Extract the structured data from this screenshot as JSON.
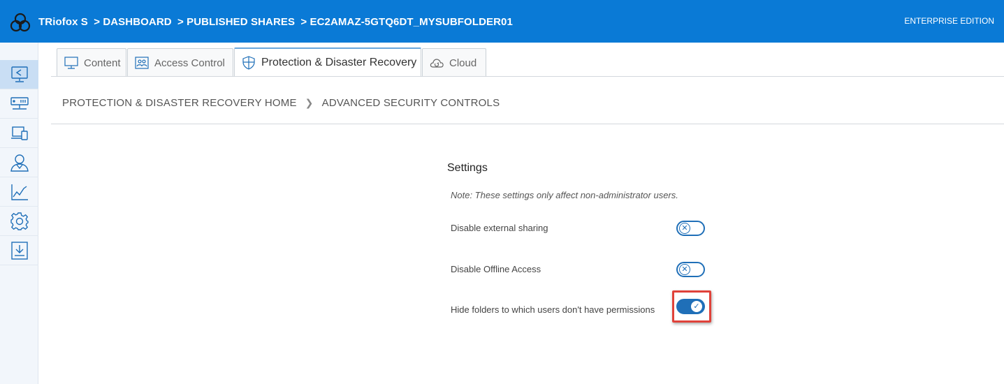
{
  "header": {
    "breadcrumb": [
      "TRiofox S",
      "> DASHBOARD",
      "> PUBLISHED SHARES",
      "> EC2AMAZ-5GTQ6DT_MYSUBFOLDER01"
    ],
    "edition": "ENTERPRISE EDITION",
    "color": "#0a7ad6"
  },
  "sidebar": {
    "items": [
      {
        "icon": "share-screen-icon",
        "active": true
      },
      {
        "icon": "server-icon",
        "active": false
      },
      {
        "icon": "devices-icon",
        "active": false
      },
      {
        "icon": "user-icon",
        "active": false
      },
      {
        "icon": "chart-icon",
        "active": false
      },
      {
        "icon": "gear-icon",
        "active": false
      },
      {
        "icon": "download-icon",
        "active": false
      }
    ]
  },
  "tabs": [
    {
      "label": "Content",
      "icon": "monitor-icon",
      "active": false
    },
    {
      "label": "Access Control",
      "icon": "users-icon",
      "active": false
    },
    {
      "label": "Protection & Disaster Recovery",
      "icon": "shield-icon",
      "active": true
    },
    {
      "label": "Cloud",
      "icon": "cloud-icon",
      "active": false
    }
  ],
  "subcrumb": {
    "home": "PROTECTION & DISASTER RECOVERY HOME",
    "current": "ADVANCED SECURITY CONTROLS"
  },
  "settings": {
    "title": "Settings",
    "note": "Note: These settings only affect non-administrator users.",
    "items": [
      {
        "label": "Disable external sharing",
        "enabled": false
      },
      {
        "label": "Disable Offline Access",
        "enabled": false
      },
      {
        "label": "Hide folders to which users don't have permissions",
        "enabled": true
      }
    ],
    "toggle_color": "#1f6fb8",
    "highlight_color": "#e0423a"
  }
}
